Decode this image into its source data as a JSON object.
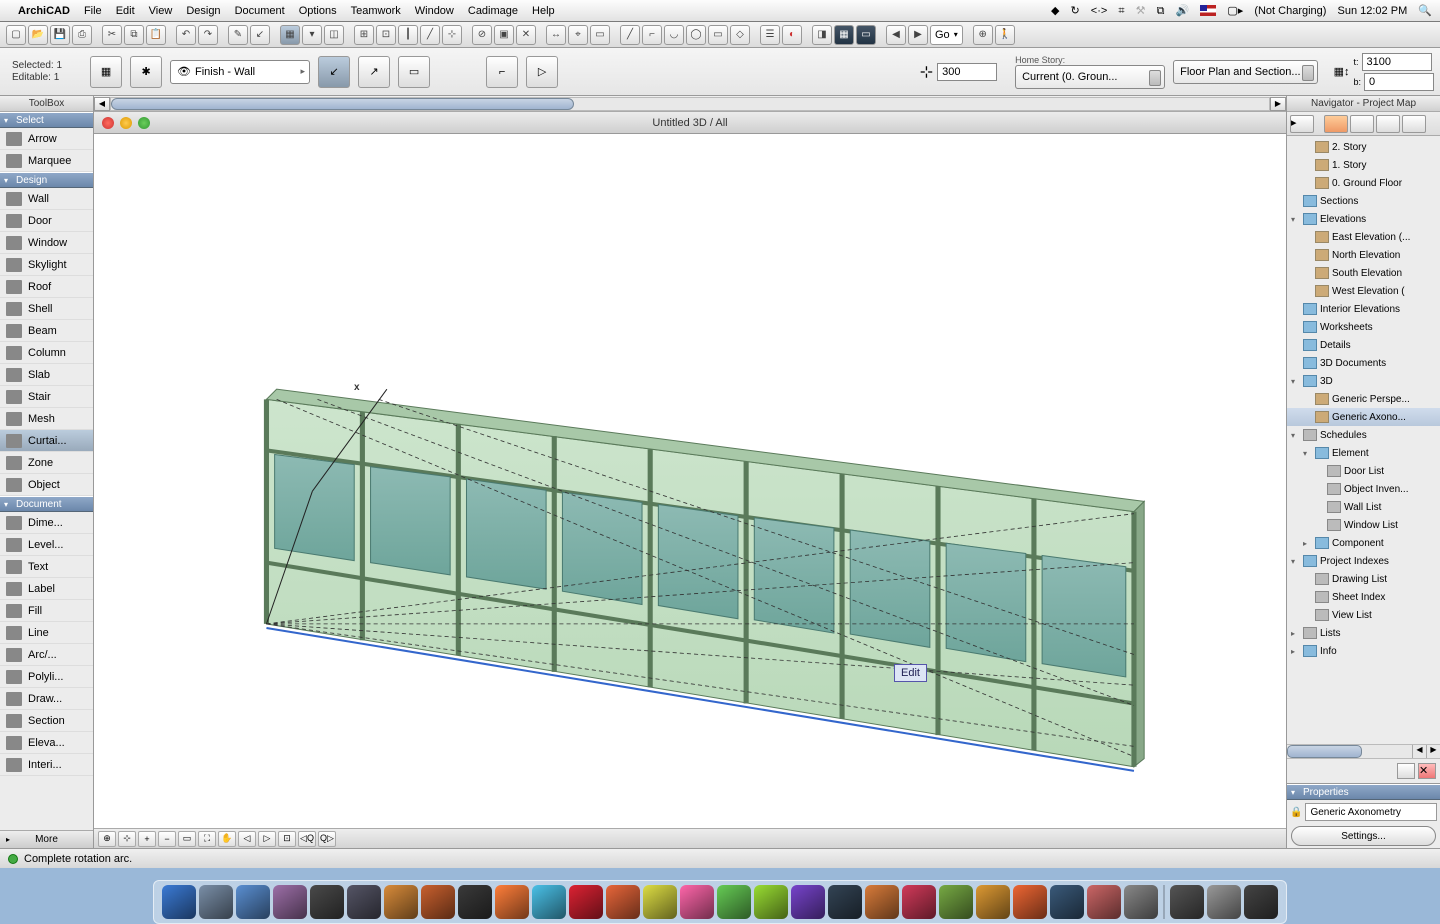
{
  "menubar": {
    "app": "ArchiCAD",
    "items": [
      "File",
      "Edit",
      "View",
      "Design",
      "Document",
      "Options",
      "Teamwork",
      "Window",
      "Cadimage",
      "Help"
    ],
    "battery": "(Not Charging)",
    "clock": "Sun 12:02 PM"
  },
  "toolbar": {
    "go_label": "Go"
  },
  "infobar": {
    "selected": "Selected: 1",
    "editable": "Editable: 1",
    "layer_label": "Finish - Wall",
    "coord_value": "300",
    "home_story_label": "Home Story:",
    "story_value": "Current (0. Groun...",
    "floorplan_label": "Floor Plan and Section...",
    "t_label": "t:",
    "t_value": "3100",
    "b_label": "b:",
    "b_value": "0"
  },
  "toolbox": {
    "title": "ToolBox",
    "sections": {
      "select": "Select",
      "design": "Design",
      "document": "Document",
      "more": "More"
    },
    "select_tools": [
      "Arrow",
      "Marquee"
    ],
    "design_tools": [
      "Wall",
      "Door",
      "Window",
      "Skylight",
      "Roof",
      "Shell",
      "Beam",
      "Column",
      "Slab",
      "Stair",
      "Mesh",
      "Curtai...",
      "Zone",
      "Object"
    ],
    "document_tools": [
      "Dime...",
      "Level...",
      "Text",
      "Label",
      "Fill",
      "Line",
      "Arc/...",
      "Polyli...",
      "Draw...",
      "Section",
      "Eleva...",
      "Interi..."
    ],
    "selected_tool": "Curtai..."
  },
  "viewport": {
    "title": "Untitled 3D / All",
    "axis_label": "x",
    "edit_tooltip": "Edit"
  },
  "navigator": {
    "title": "Navigator - Project Map",
    "tree": [
      {
        "indent": 1,
        "icon": "folder",
        "label": "2. Story"
      },
      {
        "indent": 1,
        "icon": "folder",
        "label": "1. Story"
      },
      {
        "indent": 1,
        "icon": "folder",
        "label": "0. Ground Floor"
      },
      {
        "indent": 0,
        "tri": "",
        "icon": "blue",
        "label": "Sections"
      },
      {
        "indent": 0,
        "tri": "▾",
        "icon": "blue",
        "label": "Elevations"
      },
      {
        "indent": 1,
        "icon": "folder",
        "label": "East Elevation (..."
      },
      {
        "indent": 1,
        "icon": "folder",
        "label": "North Elevation"
      },
      {
        "indent": 1,
        "icon": "folder",
        "label": "South Elevation"
      },
      {
        "indent": 1,
        "icon": "folder",
        "label": "West Elevation ("
      },
      {
        "indent": 0,
        "tri": "",
        "icon": "blue",
        "label": "Interior Elevations"
      },
      {
        "indent": 0,
        "tri": "",
        "icon": "blue",
        "label": "Worksheets"
      },
      {
        "indent": 0,
        "tri": "",
        "icon": "blue",
        "label": "Details"
      },
      {
        "indent": 0,
        "tri": "",
        "icon": "blue",
        "label": "3D Documents"
      },
      {
        "indent": 0,
        "tri": "▾",
        "icon": "blue",
        "label": "3D"
      },
      {
        "indent": 1,
        "icon": "folder",
        "label": "Generic Perspe..."
      },
      {
        "indent": 1,
        "icon": "folder",
        "label": "Generic Axono...",
        "sel": true
      },
      {
        "indent": 0,
        "tri": "▾",
        "icon": "grey",
        "label": "Schedules"
      },
      {
        "indent": 1,
        "tri": "▾",
        "icon": "blue",
        "label": "Element"
      },
      {
        "indent": 2,
        "icon": "grey",
        "label": "Door List"
      },
      {
        "indent": 2,
        "icon": "grey",
        "label": "Object Inven..."
      },
      {
        "indent": 2,
        "icon": "grey",
        "label": "Wall List"
      },
      {
        "indent": 2,
        "icon": "grey",
        "label": "Window List"
      },
      {
        "indent": 1,
        "tri": "▸",
        "icon": "blue",
        "label": "Component"
      },
      {
        "indent": 0,
        "tri": "▾",
        "icon": "blue",
        "label": "Project Indexes"
      },
      {
        "indent": 1,
        "icon": "grey",
        "label": "Drawing List"
      },
      {
        "indent": 1,
        "icon": "grey",
        "label": "Sheet Index"
      },
      {
        "indent": 1,
        "icon": "grey",
        "label": "View List"
      },
      {
        "indent": 0,
        "tri": "▸",
        "icon": "grey",
        "label": "Lists"
      },
      {
        "indent": 0,
        "tri": "▸",
        "icon": "blue",
        "label": "Info"
      }
    ]
  },
  "properties": {
    "title": "Properties",
    "value": "Generic Axonometry",
    "settings": "Settings..."
  },
  "statusbar": {
    "message": "Complete rotation arc."
  },
  "dock_colors": [
    "#3b7bd6",
    "#7a8fa8",
    "#5a8fd2",
    "#9d6fa8",
    "#4a4a4a",
    "#556",
    "#d88b3a",
    "#c9602e",
    "#3a3a3a",
    "#ff7e3a",
    "#4ac1e8",
    "#d23",
    "#e8663a",
    "#dd4",
    "#f6a",
    "#6c5",
    "#9d3",
    "#74c",
    "#345",
    "#d87b3a",
    "#d23a5a",
    "#7a4",
    "#d93",
    "#e63",
    "#3a5a7a",
    "#c66",
    "#888",
    "#555",
    "#999",
    "#444"
  ]
}
